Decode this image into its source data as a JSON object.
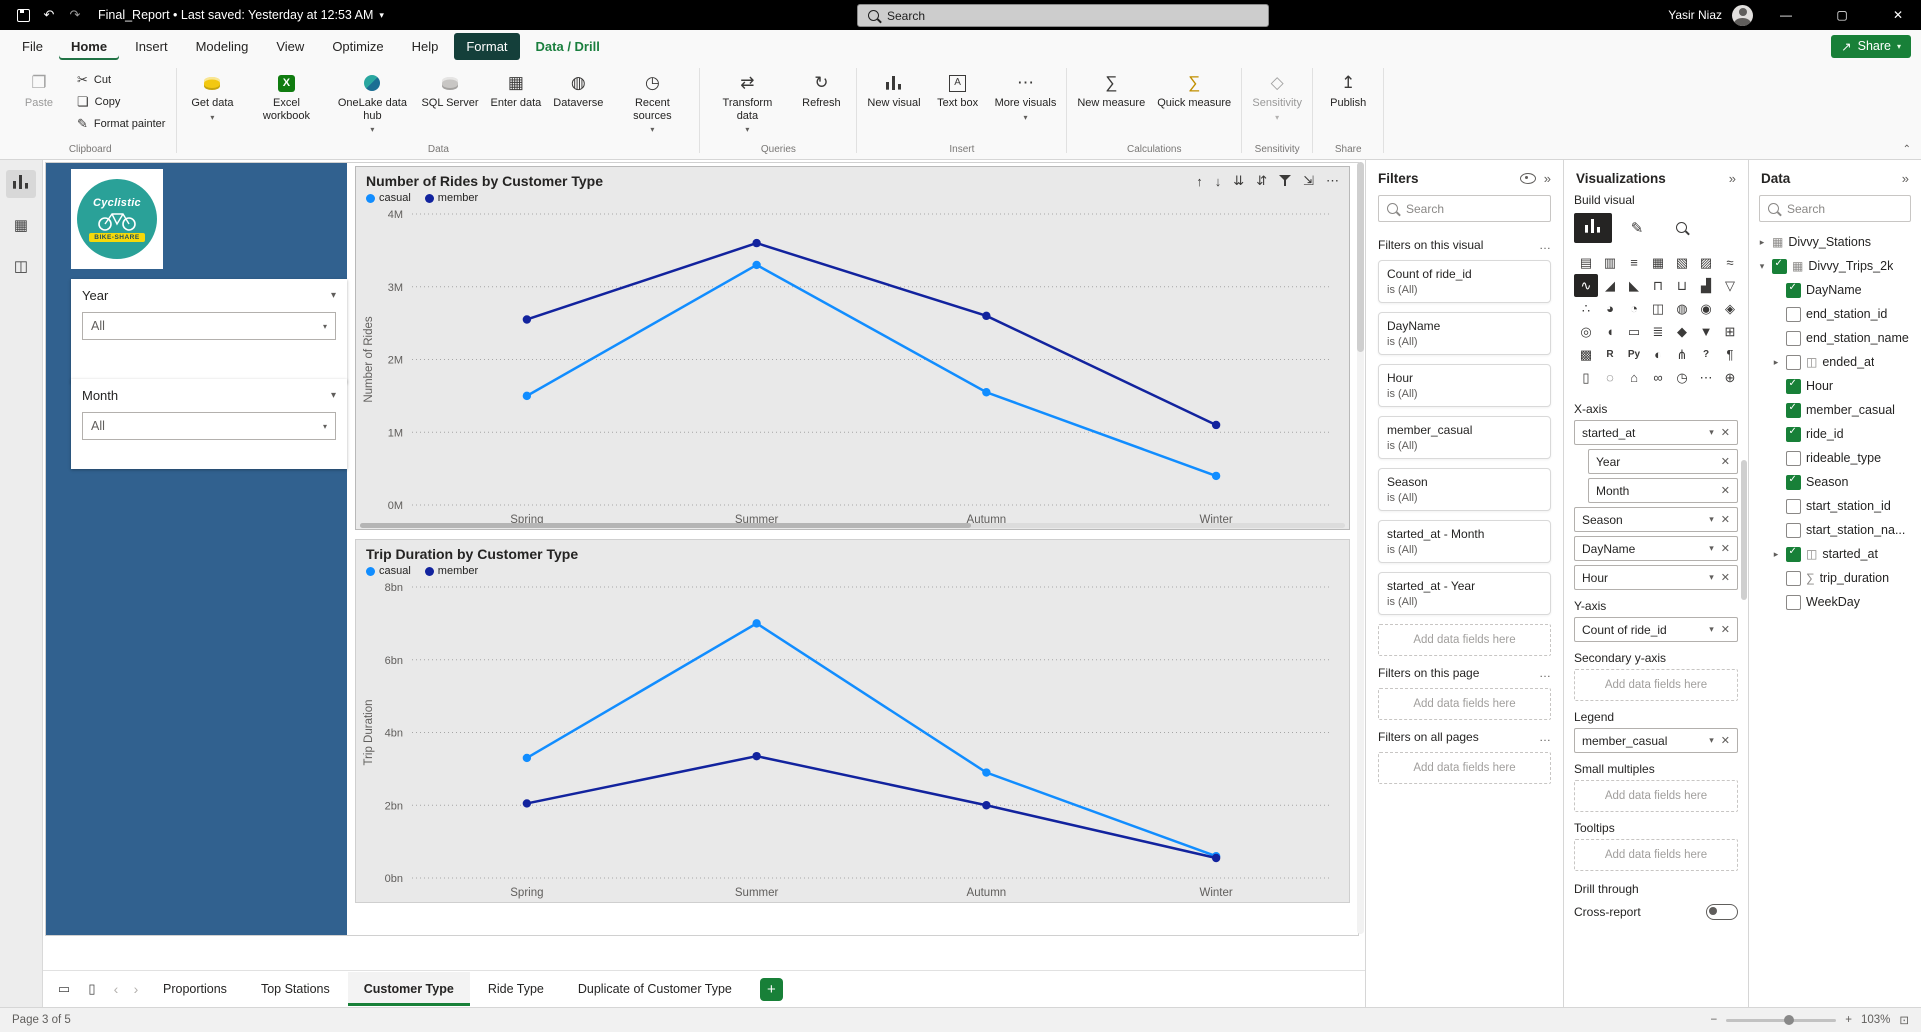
{
  "titlebar": {
    "title": "Final_Report • Last saved: Yesterday at 12:53 AM",
    "search_placeholder": "Search",
    "user": "Yasir Niaz"
  },
  "ribbon": {
    "tabs": [
      {
        "label": "File"
      },
      {
        "label": "Home",
        "active": true
      },
      {
        "label": "Insert"
      },
      {
        "label": "Modeling"
      },
      {
        "label": "View"
      },
      {
        "label": "Optimize"
      },
      {
        "label": "Help"
      },
      {
        "label": "Format",
        "contextual": true
      },
      {
        "label": "Data / Drill",
        "contextual_text": true
      }
    ],
    "share_label": "Share",
    "groups": [
      {
        "label": "Clipboard",
        "buttons": [
          {
            "label": "Paste",
            "icon": "paste-icon",
            "size": "large",
            "disabled": true
          },
          {
            "label": "Cut",
            "icon": "cut-icon",
            "size": "small"
          },
          {
            "label": "Copy",
            "icon": "copy-icon",
            "size": "small"
          },
          {
            "label": "Format painter",
            "icon": "format-painter-icon",
            "size": "small"
          }
        ]
      },
      {
        "label": "Data",
        "buttons": [
          {
            "label": "Get data",
            "icon": "get-data-icon",
            "dropdown": true
          },
          {
            "label": "Excel workbook",
            "icon": "excel-icon"
          },
          {
            "label": "OneLake data hub",
            "icon": "onelake-icon",
            "dropdown": true
          },
          {
            "label": "SQL Server",
            "icon": "sql-server-icon"
          },
          {
            "label": "Enter data",
            "icon": "enter-data-icon"
          },
          {
            "label": "Dataverse",
            "icon": "dataverse-icon"
          },
          {
            "label": "Recent sources",
            "icon": "recent-sources-icon",
            "dropdown": true
          }
        ]
      },
      {
        "label": "Queries",
        "buttons": [
          {
            "label": "Transform data",
            "icon": "transform-data-icon",
            "dropdown": true
          },
          {
            "label": "Refresh",
            "icon": "refresh-icon"
          }
        ]
      },
      {
        "label": "Insert",
        "buttons": [
          {
            "label": "New visual",
            "icon": "new-visual-icon"
          },
          {
            "label": "Text box",
            "icon": "text-box-icon"
          },
          {
            "label": "More visuals",
            "icon": "more-visuals-icon",
            "dropdown": true
          }
        ]
      },
      {
        "label": "Calculations",
        "buttons": [
          {
            "label": "New measure",
            "icon": "new-measure-icon"
          },
          {
            "label": "Quick measure",
            "icon": "quick-measure-icon"
          }
        ]
      },
      {
        "label": "Sensitivity",
        "buttons": [
          {
            "label": "Sensitivity",
            "icon": "sensitivity-icon",
            "dropdown": true,
            "disabled": true
          }
        ]
      },
      {
        "label": "Share",
        "buttons": [
          {
            "label": "Publish",
            "icon": "publish-icon"
          }
        ]
      }
    ]
  },
  "rail": {
    "items": [
      {
        "name": "report-view-icon",
        "active": true
      },
      {
        "name": "data-view-icon"
      },
      {
        "name": "model-view-icon"
      }
    ]
  },
  "report": {
    "logo": {
      "brand": "Cyclistic",
      "tagline": "BIKE-SHARE"
    },
    "slicers": [
      {
        "title": "Year",
        "value": "All"
      },
      {
        "title": "Month",
        "value": "All"
      }
    ]
  },
  "chart_toolbar": [
    "drill-up-icon",
    "drill-down-icon",
    "expand-next-level-icon",
    "drill-mode-icon",
    "filter-icon",
    "focus-mode-icon",
    "more-options-icon"
  ],
  "chart_data": [
    {
      "type": "line",
      "title": "Number of Rides by Customer Type",
      "categories": [
        "Spring",
        "Summer",
        "Autumn",
        "Winter"
      ],
      "series": [
        {
          "name": "casual",
          "color": "#118DFF",
          "values": [
            1.5,
            3.3,
            1.55,
            0.4
          ]
        },
        {
          "name": "member",
          "color": "#12239E",
          "values": [
            2.55,
            3.6,
            2.6,
            1.1
          ]
        }
      ],
      "unit": "millions",
      "ylabel": "Number of Rides",
      "ylim": [
        0,
        4
      ],
      "yticks": [
        0,
        1,
        2,
        3,
        4
      ],
      "ytick_labels": [
        "0M",
        "1M",
        "2M",
        "3M",
        "4M"
      ],
      "grid": "dotted horizontal",
      "legend_position": "top-left",
      "selected": true
    },
    {
      "type": "line",
      "title": "Trip Duration by Customer Type",
      "categories": [
        "Spring",
        "Summer",
        "Autumn",
        "Winter"
      ],
      "series": [
        {
          "name": "casual",
          "color": "#118DFF",
          "values": [
            3.3,
            7.0,
            2.9,
            0.6
          ]
        },
        {
          "name": "member",
          "color": "#12239E",
          "values": [
            2.05,
            3.35,
            2.0,
            0.55
          ]
        }
      ],
      "unit": "billions",
      "ylabel": "Trip Duration",
      "ylim": [
        0,
        8
      ],
      "yticks": [
        0,
        2,
        4,
        6,
        8
      ],
      "ytick_labels": [
        "0bn",
        "2bn",
        "4bn",
        "6bn",
        "8bn"
      ],
      "grid": "dotted horizontal",
      "legend_position": "top-left",
      "selected": false
    }
  ],
  "filters": {
    "title": "Filters",
    "search_placeholder": "Search",
    "sections": [
      {
        "title": "Filters on this visual",
        "cards": [
          {
            "field": "Count of ride_id",
            "condition": "is (All)"
          },
          {
            "field": "DayName",
            "condition": "is (All)"
          },
          {
            "field": "Hour",
            "condition": "is (All)"
          },
          {
            "field": "member_casual",
            "condition": "is (All)"
          },
          {
            "field": "Season",
            "condition": "is (All)"
          },
          {
            "field": "started_at - Month",
            "condition": "is (All)"
          },
          {
            "field": "started_at - Year",
            "condition": "is (All)"
          }
        ],
        "placeholder": "Add data fields here"
      },
      {
        "title": "Filters on this page",
        "cards": [],
        "placeholder": "Add data fields here"
      },
      {
        "title": "Filters on all pages",
        "cards": [],
        "placeholder": "Add data fields here"
      }
    ]
  },
  "visualizations": {
    "title": "Visualizations",
    "build_label": "Build visual",
    "mode_tabs": [
      "build-visual-icon",
      "format-visual-icon",
      "analytics-icon"
    ],
    "selected_mode": "build-visual-icon",
    "visual_types": [
      "stacked-bar-chart",
      "stacked-column-chart",
      "clustered-bar-chart",
      "clustered-column-chart",
      "100-stacked-bar-chart",
      "100-stacked-column-chart",
      "ribbon-chart",
      "line-chart",
      "area-chart",
      "stacked-area-chart",
      "line-and-stacked-column-chart",
      "line-and-clustered-column-chart",
      "waterfall-chart",
      "funnel-chart",
      "scatter-chart",
      "pie-chart",
      "donut-chart",
      "treemap",
      "map",
      "filled-map",
      "shape-map",
      "azure-map",
      "gauge",
      "card",
      "multi-row-card",
      "kpi",
      "slicer",
      "table",
      "matrix",
      "r-script-visual",
      "python-visual",
      "key-influencers",
      "decomposition-tree",
      "qa-visual",
      "smart-narrative",
      "paginated-report",
      "arcgis-map",
      "power-apps-visual",
      "power-automate-visual",
      "metrics-visual",
      "get-more-visuals",
      "pin-visual"
    ],
    "selected_visual": "line-chart",
    "wells": [
      {
        "label": "X-axis",
        "pills": [
          {
            "text": "started_at"
          },
          {
            "text": "Year",
            "sub": true
          },
          {
            "text": "Month",
            "sub": true
          },
          {
            "text": "Season"
          },
          {
            "text": "DayName"
          },
          {
            "text": "Hour"
          }
        ]
      },
      {
        "label": "Y-axis",
        "pills": [
          {
            "text": "Count of ride_id"
          }
        ]
      },
      {
        "label": "Secondary y-axis",
        "pills": [],
        "placeholder": "Add data fields here"
      },
      {
        "label": "Legend",
        "pills": [
          {
            "text": "member_casual"
          }
        ]
      },
      {
        "label": "Small multiples",
        "pills": [],
        "placeholder": "Add data fields here"
      },
      {
        "label": "Tooltips",
        "pills": [],
        "placeholder": "Add data fields here"
      }
    ],
    "drill_through_label": "Drill through",
    "cross_report_label": "Cross-report"
  },
  "data_pane": {
    "title": "Data",
    "search_placeholder": "Search",
    "fields": [
      {
        "label": "Divvy_Stations",
        "level": 0,
        "chevron": "collapsed",
        "icon": "table-icon"
      },
      {
        "label": "Divvy_Trips_2k",
        "level": 0,
        "chevron": "expanded",
        "checked": true,
        "icon": "table-icon"
      },
      {
        "label": "DayName",
        "level": 1,
        "checked": true
      },
      {
        "label": "end_station_id",
        "level": 1,
        "checked": false
      },
      {
        "label": "end_station_name",
        "level": 1,
        "checked": false
      },
      {
        "label": "ended_at",
        "level": 1,
        "checked": false,
        "chevron": "collapsed",
        "icon": "date-icon"
      },
      {
        "label": "Hour",
        "level": 1,
        "checked": true
      },
      {
        "label": "member_casual",
        "level": 1,
        "checked": true
      },
      {
        "label": "ride_id",
        "level": 1,
        "checked": true
      },
      {
        "label": "rideable_type",
        "level": 1,
        "checked": false
      },
      {
        "label": "Season",
        "level": 1,
        "checked": true
      },
      {
        "label": "start_station_id",
        "level": 1,
        "checked": false
      },
      {
        "label": "start_station_na...",
        "level": 1,
        "checked": false
      },
      {
        "label": "started_at",
        "level": 1,
        "checked": true,
        "chevron": "collapsed",
        "icon": "date-icon"
      },
      {
        "label": "trip_duration",
        "level": 1,
        "checked": false,
        "icon": "sum-icon"
      },
      {
        "label": "WeekDay",
        "level": 1,
        "checked": false
      }
    ]
  },
  "pages": {
    "view_icons": [
      {
        "name": "desktop-view-icon",
        "active": true
      },
      {
        "name": "mobile-view-icon"
      }
    ],
    "tabs": [
      {
        "label": "Proportions"
      },
      {
        "label": "Top Stations"
      },
      {
        "label": "Customer Type",
        "active": true
      },
      {
        "label": "Ride Type"
      },
      {
        "label": "Duplicate of Customer Type"
      }
    ]
  },
  "statusbar": {
    "page_indicator": "Page 3 of 5",
    "zoom": "103%"
  },
  "colors": {
    "accent_green": "#188038",
    "casual_blue": "#118DFF",
    "member_blue": "#12239E",
    "sidebar_blue": "#31618F",
    "titlebar_black": "#000000"
  }
}
